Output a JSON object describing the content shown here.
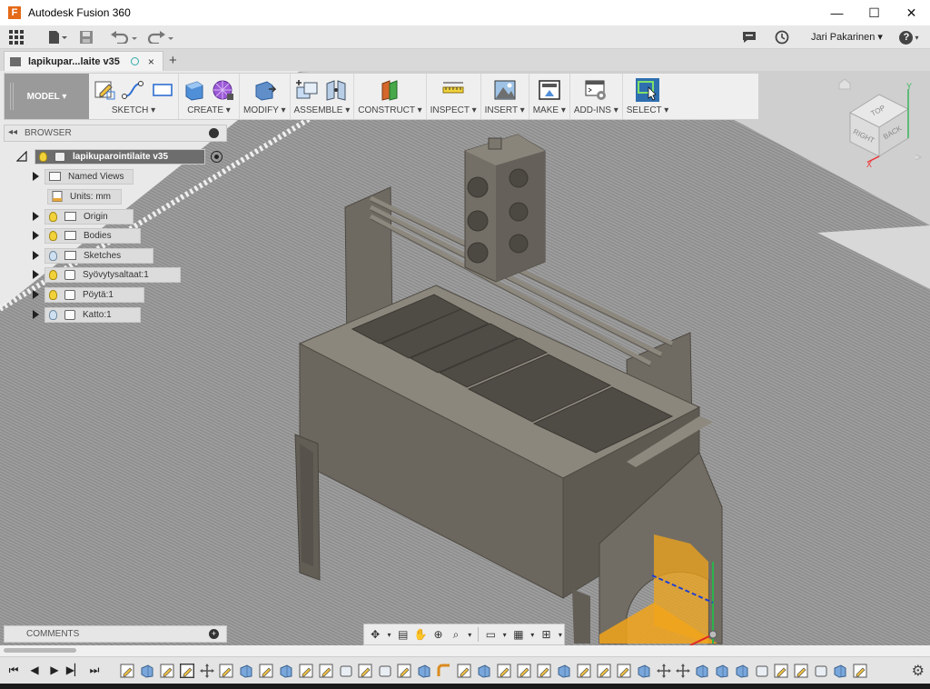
{
  "window": {
    "title": "Autodesk Fusion 360",
    "logo_letter": "F",
    "controls": {
      "minimize": "—",
      "maximize": "☐",
      "close": "✕"
    }
  },
  "appbar": {
    "user": "Jari Pakarinen ▾",
    "help": "?"
  },
  "tab": {
    "label": "lapikupar...laite v35",
    "close": "×",
    "new": "+"
  },
  "toolbar": {
    "workspace": "MODEL ▾",
    "groups": [
      {
        "label": "SKETCH ▾"
      },
      {
        "label": "CREATE ▾"
      },
      {
        "label": "MODIFY ▾"
      },
      {
        "label": "ASSEMBLE ▾"
      },
      {
        "label": "CONSTRUCT ▾"
      },
      {
        "label": "INSPECT ▾"
      },
      {
        "label": "INSERT ▾"
      },
      {
        "label": "MAKE ▾"
      },
      {
        "label": "ADD-INS ▾"
      },
      {
        "label": "SELECT ▾"
      }
    ]
  },
  "browser": {
    "header": "BROWSER",
    "root": "lapikuparointilaite v35",
    "items": [
      {
        "label": "Named Views"
      },
      {
        "label": "Units: mm"
      },
      {
        "label": "Origin"
      },
      {
        "label": "Bodies"
      },
      {
        "label": "Sketches"
      },
      {
        "label": "Syövytysaltaat:1"
      },
      {
        "label": "Pöytä:1"
      },
      {
        "label": "Katto:1"
      }
    ]
  },
  "comments": {
    "label": "COMMENTS"
  },
  "viewcube": {
    "top": "TOP",
    "front": "RIGHT",
    "right": "BACK",
    "axis_x": "X",
    "axis_y": "Y"
  },
  "colors": {
    "workspace_bg": "#9a9a9a",
    "select_accent": "#2e6fb0",
    "model_body": "#6b665c",
    "plane_orange": "#f2a51a"
  }
}
